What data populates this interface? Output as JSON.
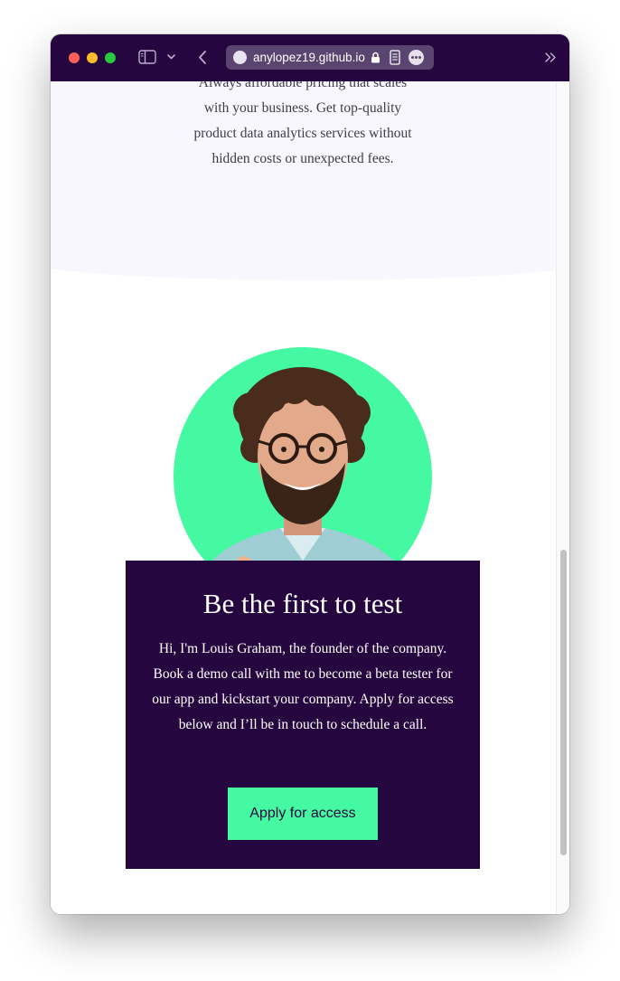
{
  "browser": {
    "url_text": "anylopez19.github.io",
    "theme_color": "#25063e"
  },
  "pricing": {
    "text": "Always affordable pricing that scales with your business. Get top-quality product data analytics services without hidden costs or unexpected fees."
  },
  "founder": {
    "photo_icon": "founder-portrait",
    "circle_color": "#45f8a2"
  },
  "cta": {
    "title": "Be the first to test",
    "body": "Hi, I'm Louis Graham, the founder of the company. Book a demo call with me to become a beta tester for our app and kickstart your company. Apply for access below and I’ll be in touch to schedule a call.",
    "button_label": "Apply for access",
    "button_color": "#45f8a2",
    "card_color": "#25063e"
  }
}
